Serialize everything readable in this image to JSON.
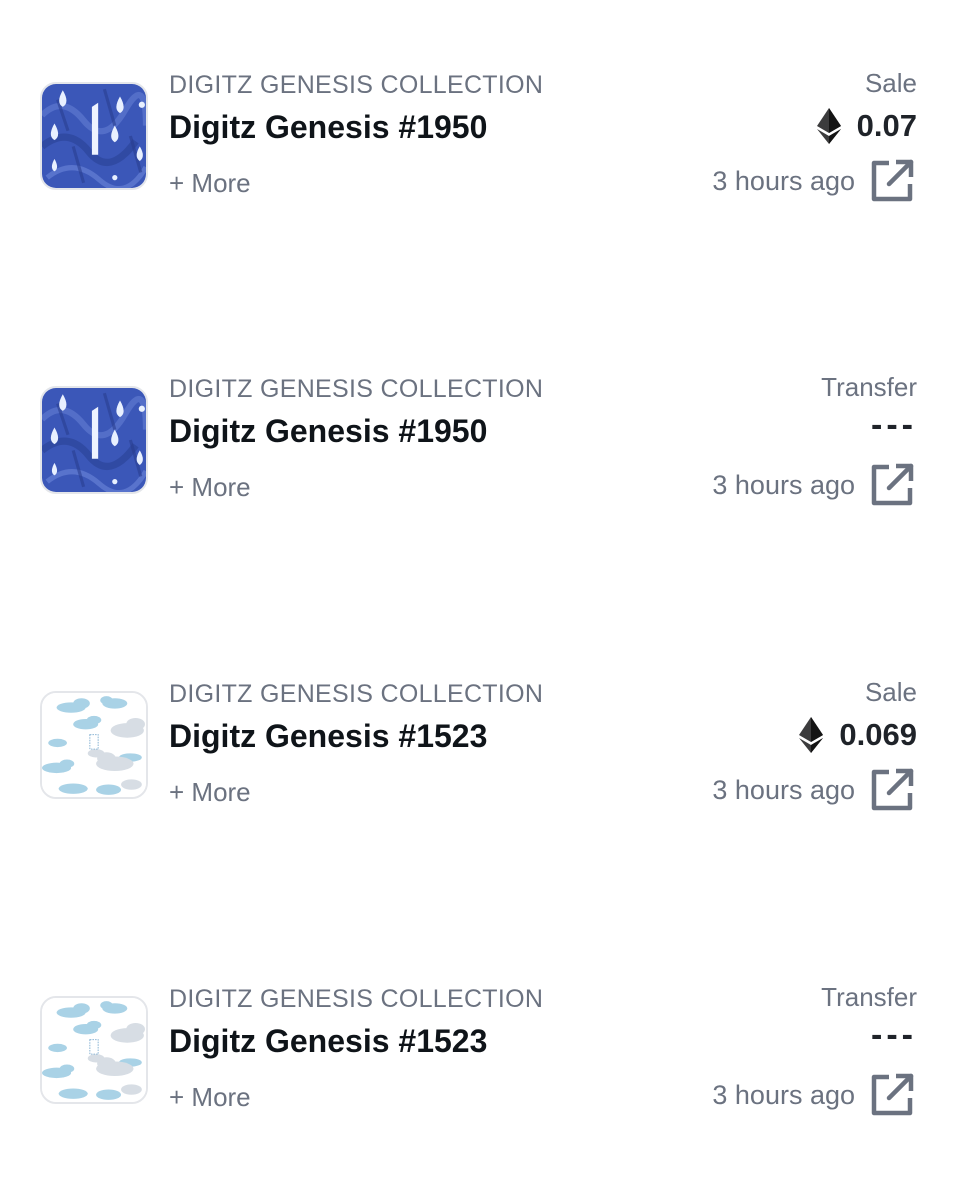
{
  "activities": [
    {
      "collection": "DIGITZ GENESIS COLLECTION",
      "name": "Digitz Genesis #1950",
      "more": "+ More",
      "event": "Sale",
      "price": "0.07",
      "time": "3 hours ago",
      "thumbnail_icon": "blue-raindrops-nft-thumbnail",
      "thumbnail_digit": "1"
    },
    {
      "collection": "DIGITZ GENESIS COLLECTION",
      "name": "Digitz Genesis #1950",
      "more": "+ More",
      "event": "Transfer",
      "price": "---",
      "time": "3 hours ago",
      "thumbnail_icon": "blue-raindrops-nft-thumbnail",
      "thumbnail_digit": "1"
    },
    {
      "collection": "DIGITZ GENESIS COLLECTION",
      "name": "Digitz Genesis #1523",
      "more": "+ More",
      "event": "Sale",
      "price": "0.069",
      "time": "3 hours ago",
      "thumbnail_icon": "clouds-nft-thumbnail"
    },
    {
      "collection": "DIGITZ GENESIS COLLECTION",
      "name": "Digitz Genesis #1523",
      "more": "+ More",
      "event": "Transfer",
      "price": "---",
      "time": "3 hours ago",
      "thumbnail_icon": "clouds-nft-thumbnail"
    }
  ],
  "icons": {
    "currency": "ethereum-icon",
    "link": "external-link-icon"
  },
  "colors": {
    "muted_text": "#6b7280",
    "primary_text": "#0f1419",
    "thumb_blue": "#3b57b8",
    "cloud_blue": "#9fcbe0"
  }
}
